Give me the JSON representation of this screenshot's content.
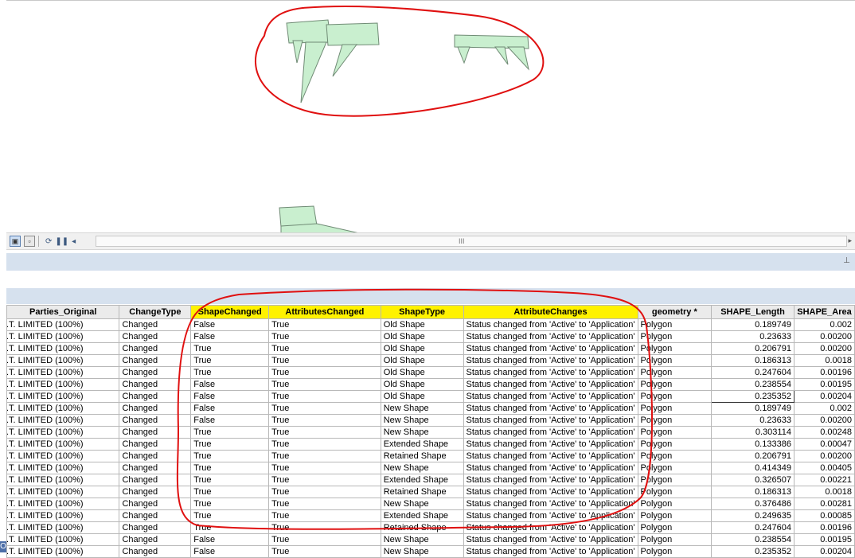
{
  "toolbar": {
    "buttons": [
      "data-view",
      "layout-view",
      "refresh",
      "pause",
      "scroll-left"
    ],
    "scroll_grip": "III",
    "right_arrow": "▸"
  },
  "panel": {
    "pin": "ꟸ"
  },
  "table": {
    "columns": [
      {
        "label": "Parties_Original",
        "highlight": false
      },
      {
        "label": "ChangeType",
        "highlight": false
      },
      {
        "label": "ShapeChanged",
        "highlight": true
      },
      {
        "label": "AttributesChanged",
        "highlight": true
      },
      {
        "label": "ShapeType",
        "highlight": true
      },
      {
        "label": "AttributeChanges",
        "highlight": true
      },
      {
        "label": "geometry *",
        "highlight": false
      },
      {
        "label": "SHAPE_Length",
        "highlight": false
      },
      {
        "label": "SHAPE_Area",
        "highlight": false
      }
    ],
    "rows": [
      [
        ".T. LIMITED (100%)",
        "Changed",
        "False",
        "True",
        "Old Shape",
        "Status changed from 'Active' to 'Application'",
        "Polygon",
        "0.189749",
        "0.002"
      ],
      [
        ".T. LIMITED (100%)",
        "Changed",
        "False",
        "True",
        "Old Shape",
        "Status changed from 'Active' to 'Application'",
        "Polygon",
        "0.23633",
        "0.00200"
      ],
      [
        ".T. LIMITED (100%)",
        "Changed",
        "True",
        "True",
        "Old Shape",
        "Status changed from 'Active' to 'Application'",
        "Polygon",
        "0.206791",
        "0.00200"
      ],
      [
        ".T. LIMITED (100%)",
        "Changed",
        "True",
        "True",
        "Old Shape",
        "Status changed from 'Active' to 'Application'",
        "Polygon",
        "0.186313",
        "0.0018"
      ],
      [
        ".T. LIMITED (100%)",
        "Changed",
        "True",
        "True",
        "Old Shape",
        "Status changed from 'Active' to 'Application'",
        "Polygon",
        "0.247604",
        "0.00196"
      ],
      [
        ".T. LIMITED (100%)",
        "Changed",
        "False",
        "True",
        "Old Shape",
        "Status changed from 'Active' to 'Application'",
        "Polygon",
        "0.238554",
        "0.00195"
      ],
      [
        ".T. LIMITED (100%)",
        "Changed",
        "False",
        "True",
        "Old Shape",
        "Status changed from 'Active' to 'Application'",
        "Polygon",
        "0.235352",
        "0.00204"
      ],
      [
        ".T. LIMITED (100%)",
        "Changed",
        "False",
        "True",
        "New Shape",
        "Status changed from 'Active' to 'Application'",
        "Polygon",
        "0.189749",
        "0.002"
      ],
      [
        ".T. LIMITED (100%)",
        "Changed",
        "False",
        "True",
        "New Shape",
        "Status changed from 'Active' to 'Application'",
        "Polygon",
        "0.23633",
        "0.00200"
      ],
      [
        ".T. LIMITED (100%)",
        "Changed",
        "True",
        "True",
        "New Shape",
        "Status changed from 'Active' to 'Application'",
        "Polygon",
        "0.303114",
        "0.00248"
      ],
      [
        ".T. LIMITED (100%)",
        "Changed",
        "True",
        "True",
        "Extended Shape",
        "Status changed from 'Active' to 'Application'",
        "Polygon",
        "0.133386",
        "0.00047"
      ],
      [
        ".T. LIMITED (100%)",
        "Changed",
        "True",
        "True",
        "Retained Shape",
        "Status changed from 'Active' to 'Application'",
        "Polygon",
        "0.206791",
        "0.00200"
      ],
      [
        ".T. LIMITED (100%)",
        "Changed",
        "True",
        "True",
        "New Shape",
        "Status changed from 'Active' to 'Application'",
        "Polygon",
        "0.414349",
        "0.00405"
      ],
      [
        ".T. LIMITED (100%)",
        "Changed",
        "True",
        "True",
        "Extended Shape",
        "Status changed from 'Active' to 'Application'",
        "Polygon",
        "0.326507",
        "0.00221"
      ],
      [
        ".T. LIMITED (100%)",
        "Changed",
        "True",
        "True",
        "Retained Shape",
        "Status changed from 'Active' to 'Application'",
        "Polygon",
        "0.186313",
        "0.0018"
      ],
      [
        ".T. LIMITED (100%)",
        "Changed",
        "True",
        "True",
        "New Shape",
        "Status changed from 'Active' to 'Application'",
        "Polygon",
        "0.376486",
        "0.00281"
      ],
      [
        ".T. LIMITED (100%)",
        "Changed",
        "True",
        "True",
        "Extended Shape",
        "Status changed from 'Active' to 'Application'",
        "Polygon",
        "0.249635",
        "0.00085"
      ],
      [
        ".T. LIMITED (100%)",
        "Changed",
        "True",
        "True",
        "Retained Shape",
        "Status changed from 'Active' to 'Application'",
        "Polygon",
        "0.247604",
        "0.00196"
      ],
      [
        ".T. LIMITED (100%)",
        "Changed",
        "False",
        "True",
        "New Shape",
        "Status changed from 'Active' to 'Application'",
        "Polygon",
        "0.238554",
        "0.00195"
      ],
      [
        ".T. LIMITED (100%)",
        "Changed",
        "False",
        "True",
        "New Shape",
        "Status changed from 'Active' to 'Application'",
        "Polygon",
        "0.235352",
        "0.00204"
      ]
    ],
    "selected_cell": {
      "row": 6,
      "col": 7
    }
  },
  "edge_mark": "O",
  "colors": {
    "polygon_fill": "#c9efcf",
    "polygon_stroke": "#6f8a74",
    "annotation_red": "#e01010",
    "header_highlight": "#fff200",
    "panel_bar": "#d6e1ee"
  }
}
